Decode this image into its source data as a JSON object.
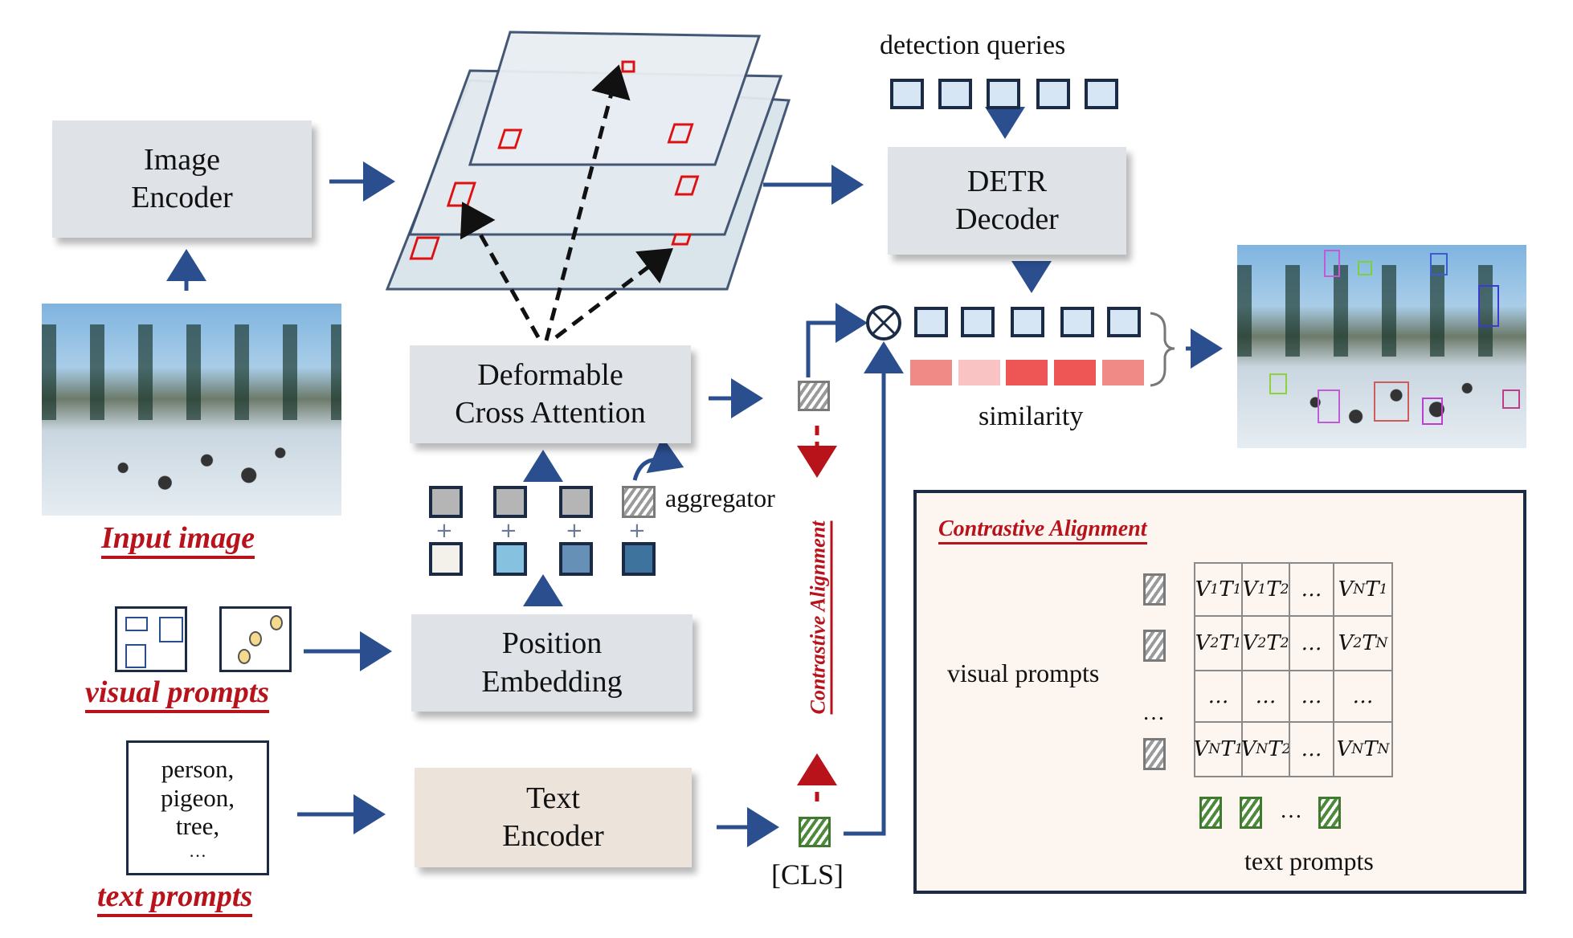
{
  "blocks": {
    "image_encoder": [
      "Image",
      "Encoder"
    ],
    "deformable_cross_attention": [
      "Deformable",
      "Cross Attention"
    ],
    "position_embedding": [
      "Position",
      "Embedding"
    ],
    "text_encoder": [
      "Text",
      "Encoder"
    ],
    "detr_decoder": [
      "DETR",
      "Decoder"
    ]
  },
  "labels": {
    "input_image": "Input image",
    "visual_prompts": "visual prompts",
    "text_prompts": "text prompts",
    "detection_queries": "detection queries",
    "similarity": "similarity",
    "aggregator": "aggregator",
    "cls": "[CLS]",
    "contrastive_alignment_vertical": "Contrastive Alignment",
    "plus": "+"
  },
  "text_prompt_list": [
    "person,",
    "pigeon,",
    "tree,",
    "…"
  ],
  "colors": {
    "arrow_blue": "#2b4f8e",
    "alignment_red": "#b8121b",
    "query_fill": "#d6e6f4",
    "visual_token_fill": "#b5b5b5",
    "position_fills": [
      "#f4f1ea",
      "#86c1e0",
      "#6690b6",
      "#3d739c"
    ],
    "similarity_fills": [
      "#f08a86",
      "#f9c3c3",
      "#ee5656",
      "#ee5656",
      "#f08a86"
    ],
    "point_prompt_fill": "#f5d98c"
  },
  "contrastive_alignment": {
    "title": "Contrastive Alignment",
    "row_label": "visual prompts",
    "col_label": "text prompts",
    "ellipsis": "…",
    "matrix": [
      [
        {
          "v": "1",
          "t": "1"
        },
        {
          "v": "1",
          "t": "2"
        },
        {
          "text": "…"
        },
        {
          "v": "N",
          "t": "1"
        }
      ],
      [
        {
          "v": "2",
          "t": "1"
        },
        {
          "v": "2",
          "t": "2"
        },
        {
          "text": "…"
        },
        {
          "v": "2",
          "t": "N"
        }
      ],
      [
        {
          "text": "…"
        },
        {
          "text": "…"
        },
        {
          "text": "…"
        },
        {
          "text": "…"
        }
      ],
      [
        {
          "v": "N",
          "t": "1"
        },
        {
          "v": "N",
          "t": "2"
        },
        {
          "text": "…"
        },
        {
          "v": "N",
          "t": "N"
        }
      ]
    ]
  }
}
